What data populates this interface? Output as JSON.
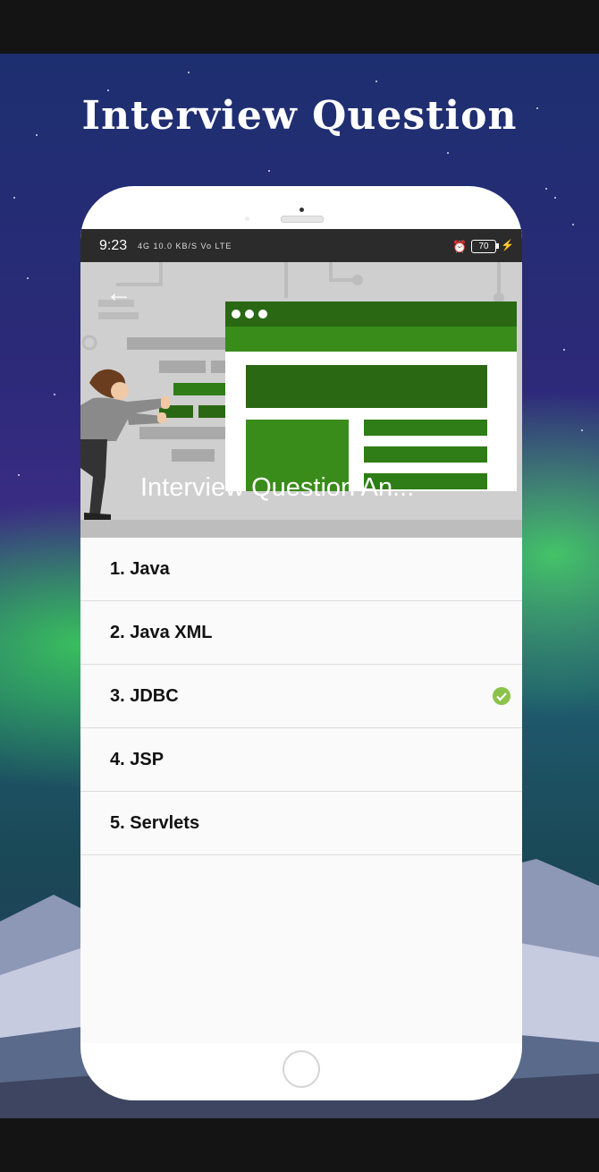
{
  "headline": "Interview Question",
  "status_bar": {
    "time": "9:23",
    "network_text": "4G  10.0 KB/S  Vo LTE",
    "battery": "70"
  },
  "app_header": {
    "title": "Interview Question An...",
    "back_icon": "arrow-left-icon"
  },
  "items": [
    {
      "label": "1. Java",
      "checked": false
    },
    {
      "label": "2. Java XML",
      "checked": false
    },
    {
      "label": "3. JDBC",
      "checked": true
    },
    {
      "label": "4. JSP",
      "checked": false
    },
    {
      "label": "5. Servlets",
      "checked": false
    }
  ],
  "colors": {
    "accent_green": "#3a8c1a",
    "dark_green": "#2a6814",
    "check_green": "#8bc34a",
    "status_bar": "#2b2b2b"
  }
}
